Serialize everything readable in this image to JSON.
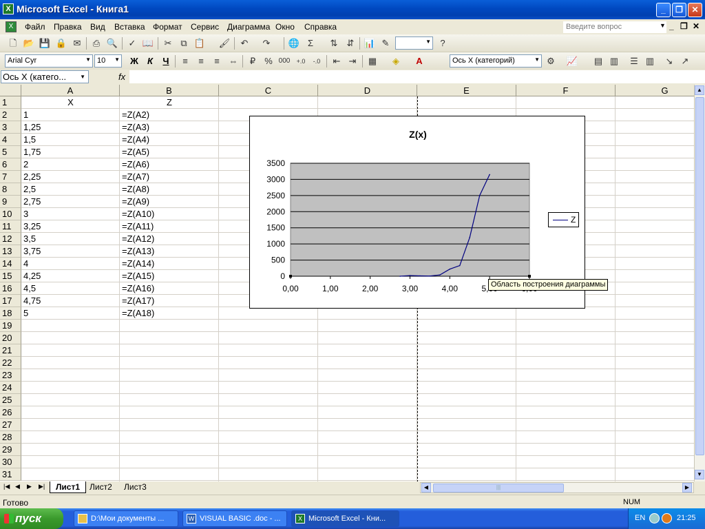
{
  "window": {
    "title": "Microsoft Excel - Книга1",
    "min": "_",
    "max": "❐",
    "close": "✕"
  },
  "menu": {
    "items": [
      "Файл",
      "Правка",
      "Вид",
      "Вставка",
      "Формат",
      "Сервис",
      "Диаграмма",
      "Окно",
      "Справка"
    ],
    "ask_placeholder": "Введите вопрос"
  },
  "toolbar_std": {
    "zoom_value": ""
  },
  "toolbar_fmt": {
    "font": "Arial Cyr",
    "size": "10",
    "bold": "Ж",
    "italic": "К",
    "underline": "Ч",
    "percent": "%",
    "thousands": "000",
    "chart_object": "Ось X (категорий)"
  },
  "formula_bar": {
    "name_box": "Ось X (катего...",
    "fx": "fx",
    "formula": ""
  },
  "columns": [
    "A",
    "B",
    "C",
    "D",
    "E",
    "F",
    "G"
  ],
  "rows": [
    "1",
    "2",
    "3",
    "4",
    "5",
    "6",
    "7",
    "8",
    "9",
    "10",
    "11",
    "12",
    "13",
    "14",
    "15",
    "16",
    "17",
    "18",
    "19",
    "20",
    "21",
    "22",
    "23",
    "24",
    "25",
    "26",
    "27",
    "28",
    "29",
    "30",
    "31"
  ],
  "cells": {
    "A1": "X",
    "B1": "Z",
    "A": [
      "1",
      "1,25",
      "1,5",
      "1,75",
      "2",
      "2,25",
      "2,5",
      "2,75",
      "3",
      "3,25",
      "3,5",
      "3,75",
      "4",
      "4,25",
      "4,5",
      "4,75",
      "5"
    ],
    "B": [
      "=Z(A2)",
      "=Z(A3)",
      "=Z(A4)",
      "=Z(A5)",
      "=Z(A6)",
      "=Z(A7)",
      "=Z(A8)",
      "=Z(A9)",
      "=Z(A10)",
      "=Z(A11)",
      "=Z(A12)",
      "=Z(A13)",
      "=Z(A14)",
      "=Z(A15)",
      "=Z(A16)",
      "=Z(A17)",
      "=Z(A18)"
    ]
  },
  "chart_data": {
    "type": "line",
    "title": "Z(x)",
    "x_ticks": [
      "0,00",
      "1,00",
      "2,00",
      "3,00",
      "4,00",
      "5,00",
      "6,00"
    ],
    "y_ticks": [
      "0",
      "500",
      "1000",
      "1500",
      "2000",
      "2500",
      "3000",
      "3500"
    ],
    "xlim": [
      0,
      6
    ],
    "ylim": [
      0,
      3500
    ],
    "grid": true,
    "plot_background": "#c0c0c0",
    "legend_position": "right",
    "series": [
      {
        "name": "Z",
        "color": "#000080",
        "x": [
          2.75,
          3.0,
          3.25,
          3.5,
          3.75,
          4.0,
          4.25,
          4.5,
          4.75,
          5.0
        ],
        "y": [
          0,
          20,
          10,
          5,
          40,
          220,
          330,
          1200,
          2500,
          3150
        ]
      }
    ]
  },
  "tooltip": "Область построения диаграммы",
  "sheets": [
    "Лист1",
    "Лист2",
    "Лист3"
  ],
  "status": {
    "ready": "Готово",
    "num": "NUM"
  },
  "taskbar": {
    "start": "пуск",
    "tasks": [
      "D:\\Мои документы ...",
      "VISUAL BASIC .doc - ...",
      "Microsoft Excel - Кни..."
    ],
    "lang": "EN",
    "time": "21:25"
  }
}
